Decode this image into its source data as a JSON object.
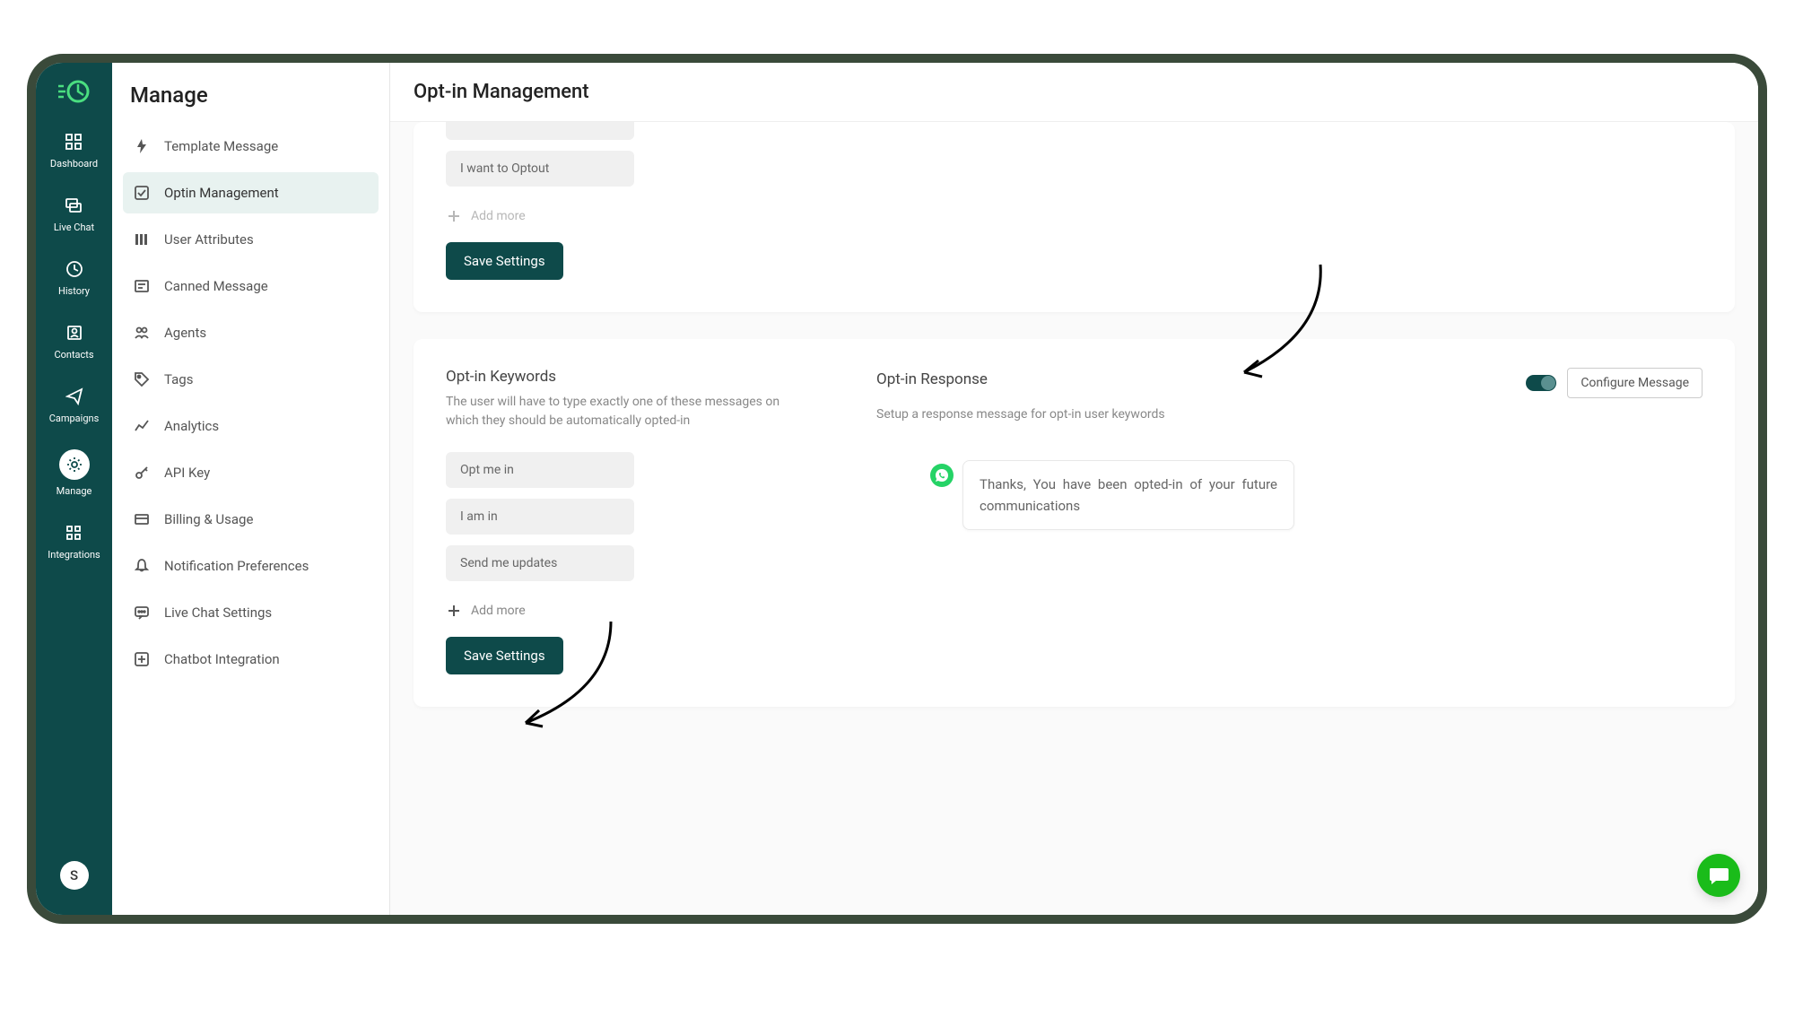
{
  "nav": {
    "items": [
      {
        "label": "Dashboard",
        "icon": "grid"
      },
      {
        "label": "Live Chat",
        "icon": "chat"
      },
      {
        "label": "History",
        "icon": "clock"
      },
      {
        "label": "Contacts",
        "icon": "contacts"
      },
      {
        "label": "Campaigns",
        "icon": "send"
      },
      {
        "label": "Manage",
        "icon": "gear"
      },
      {
        "label": "Integrations",
        "icon": "grid4"
      }
    ],
    "avatar_letter": "S"
  },
  "sidebar": {
    "title": "Manage",
    "items": [
      {
        "label": "Template Message"
      },
      {
        "label": "Optin Management"
      },
      {
        "label": "User Attributes"
      },
      {
        "label": "Canned Message"
      },
      {
        "label": "Agents"
      },
      {
        "label": "Tags"
      },
      {
        "label": "Analytics"
      },
      {
        "label": "API Key"
      },
      {
        "label": "Billing & Usage"
      },
      {
        "label": "Notification Preferences"
      },
      {
        "label": "Live Chat Settings"
      },
      {
        "label": "Chatbot Integration"
      }
    ]
  },
  "page": {
    "title": "Opt-in Management",
    "optout_section": {
      "keywords": [
        "I want to Optout"
      ],
      "add_more": "Add more",
      "save": "Save Settings"
    },
    "optin_section": {
      "title": "Opt-in Keywords",
      "desc": "The user will have to type exactly one of these messages on which they should be automatically opted-in",
      "keywords": [
        "Opt me in",
        "I am in",
        "Send me updates"
      ],
      "add_more": "Add more",
      "save": "Save Settings"
    },
    "response_section": {
      "title": "Opt-in Response",
      "desc": "Setup a response message for opt-in user keywords",
      "configure": "Configure Message",
      "bubble": "Thanks, You have been opted-in of your future communications"
    }
  }
}
